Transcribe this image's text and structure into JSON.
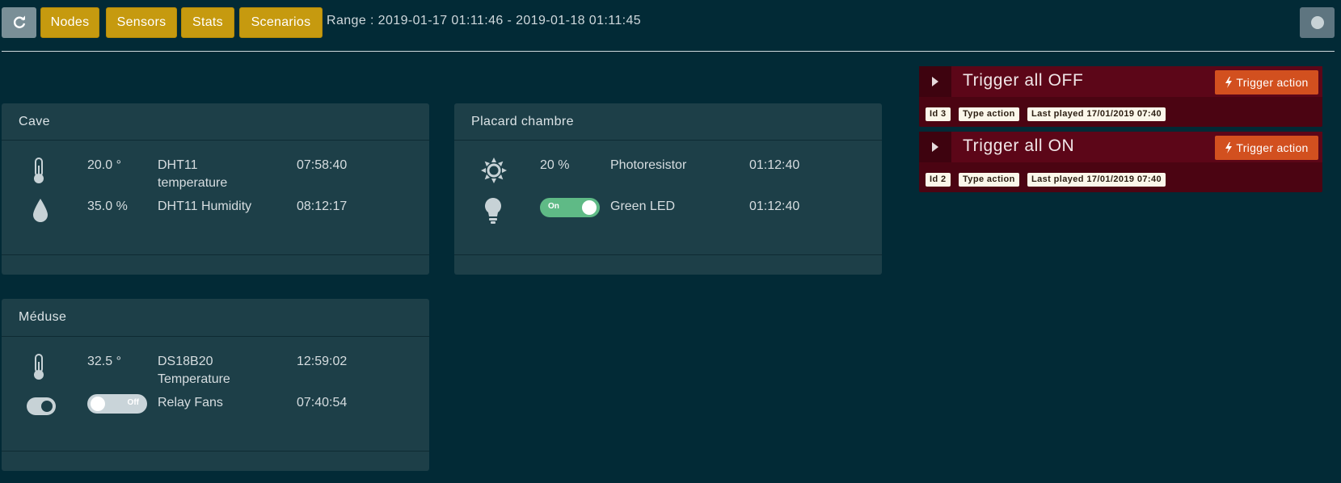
{
  "toolbar": {
    "refresh_icon": "refresh-icon",
    "nav": [
      "Nodes",
      "Sensors",
      "Stats",
      "Scenarios"
    ],
    "range": "Range : 2019-01-17 01:11:46 - 2019-01-18 01:11:45",
    "status_icon": "status-dot-icon"
  },
  "nodes": [
    {
      "name": "Cave",
      "sensors": [
        {
          "icon": "thermometer-icon",
          "value": "20.0 °",
          "label": "DHT11 temperature",
          "time": "07:58:40"
        },
        {
          "icon": "droplet-icon",
          "value": "35.0 %",
          "label": "DHT11 Humidity",
          "time": "08:12:17"
        }
      ]
    },
    {
      "name": "Placard chambre",
      "sensors": [
        {
          "icon": "sun-icon",
          "value": "20 %",
          "label": "Photoresistor",
          "time": "01:12:40"
        },
        {
          "icon": "lightbulb-icon",
          "toggle": "On",
          "label": "Green LED",
          "time": "01:12:40"
        }
      ]
    },
    {
      "name": "Méduse",
      "sensors": [
        {
          "icon": "thermometer-icon",
          "value": "32.5 °",
          "label": "DS18B20 Temperature",
          "time": "12:59:02"
        },
        {
          "icon": "toggle-icon",
          "toggle": "Off",
          "label": "Relay Fans",
          "time": "07:40:54"
        }
      ]
    }
  ],
  "scenarios": [
    {
      "title": "Trigger all OFF",
      "button": "Trigger action",
      "id": "Id 3",
      "type": "Type action",
      "last_played": "Last played 17/01/2019 07:40"
    },
    {
      "title": "Trigger all ON",
      "button": "Trigger action",
      "id": "Id 2",
      "type": "Type action",
      "last_played": "Last played 17/01/2019 07:40"
    }
  ],
  "colors": {
    "background": "#022a36",
    "nav_button": "#c69a0f",
    "panel": "#1d3f48",
    "scenario": "#5c0618",
    "trigger_button": "#d2501f",
    "toggle_on": "#5fba86"
  }
}
